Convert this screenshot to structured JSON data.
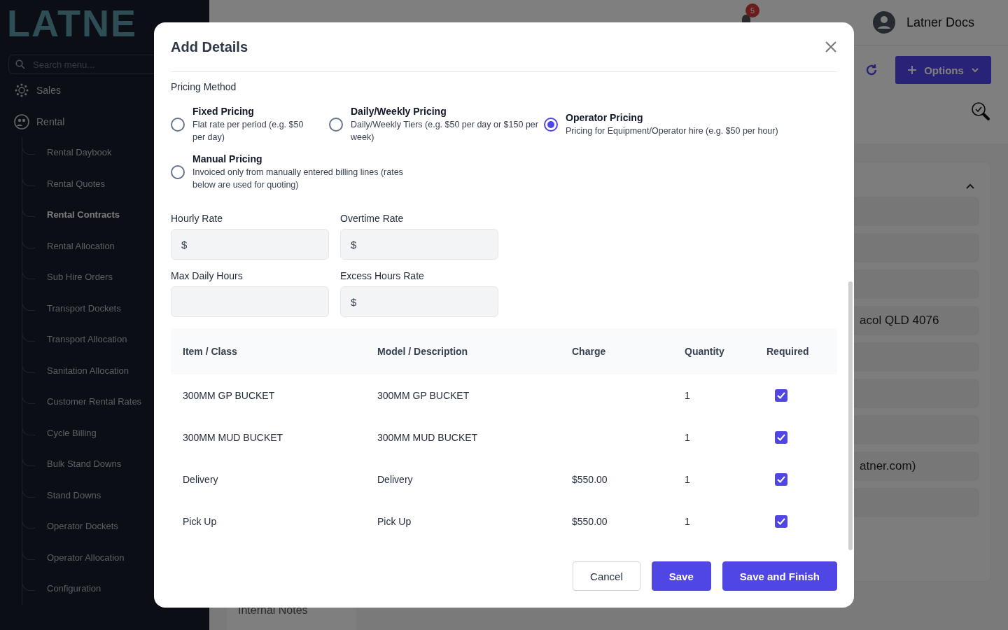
{
  "sidebar": {
    "logo": "LATNE",
    "search": {
      "placeholder": "Search menu..."
    },
    "items": [
      {
        "label": "Sales",
        "kind": "sales"
      },
      {
        "label": "Rental",
        "kind": "rental",
        "children": [
          {
            "label": "Rental Daybook",
            "selected": false
          },
          {
            "label": "Rental Quotes",
            "selected": false
          },
          {
            "label": "Rental Contracts",
            "selected": true
          },
          {
            "label": "Rental Allocation",
            "selected": false
          },
          {
            "label": "Sub Hire Orders",
            "selected": false
          },
          {
            "label": "Transport Dockets",
            "selected": false
          },
          {
            "label": "Transport Allocation",
            "selected": false
          },
          {
            "label": "Sanitation Allocation",
            "selected": false
          },
          {
            "label": "Customer Rental Rates",
            "selected": false
          },
          {
            "label": "Cycle Billing",
            "selected": false
          },
          {
            "label": "Bulk Stand Downs",
            "selected": false
          },
          {
            "label": "Stand Downs",
            "selected": false
          },
          {
            "label": "Operator Dockets",
            "selected": false
          },
          {
            "label": "Operator Allocation",
            "selected": false
          },
          {
            "label": "Configuration",
            "selected": false
          }
        ]
      }
    ]
  },
  "header": {
    "notification_count": "5",
    "user": "Latner Docs"
  },
  "toolbar": {
    "options_button": "Options"
  },
  "details_card": {
    "field_rows": [
      null,
      null,
      null,
      "acol QLD 4076",
      null,
      null,
      null,
      "atner.com)",
      null
    ]
  },
  "notes_card": {
    "title": "Internal Notes"
  },
  "modal": {
    "title": "Add Details",
    "pricing_method": {
      "label": "Pricing Method",
      "options": [
        {
          "title": "Fixed Pricing",
          "description": "Flat rate per period (e.g. $50 per day)",
          "selected": false
        },
        {
          "title": "Daily/Weekly Pricing",
          "description": "Daily/Weekly Tiers (e.g. $50 per day or $150 per week)",
          "selected": false
        },
        {
          "title": "Operator Pricing",
          "description": "Pricing for Equipment/Operator hire (e.g. $50 per hour)",
          "selected": true
        },
        {
          "title": "Manual Pricing",
          "description": "Invoiced only from manually entered billing lines (rates below are used for quoting)",
          "selected": false
        }
      ]
    },
    "fields": [
      {
        "label": "Hourly Rate",
        "prefix": "$"
      },
      {
        "label": "Overtime Rate",
        "prefix": "$"
      },
      {
        "label": "Max Daily Hours"
      },
      {
        "label": "Excess Hours Rate",
        "prefix": "$"
      }
    ],
    "table": {
      "columns": [
        "Item / Class",
        "Model / Description",
        "Charge",
        "Quantity",
        "Required"
      ],
      "rows": [
        {
          "item": "300MM GP BUCKET",
          "model": "300MM GP BUCKET",
          "quantity": "1",
          "required": true
        },
        {
          "item": "300MM MUD BUCKET",
          "model": "300MM MUD BUCKET",
          "quantity": "1",
          "required": true
        },
        {
          "item": "Delivery",
          "model": "Delivery",
          "charge": "$550.00",
          "quantity": "1",
          "required": true
        },
        {
          "item": "Pick Up",
          "model": "Pick Up",
          "charge": "$550.00",
          "quantity": "1",
          "required": true
        }
      ]
    },
    "buttons": [
      {
        "label": "Cancel",
        "kind": "secondary"
      },
      {
        "label": "Save",
        "kind": "primary"
      },
      {
        "label": "Save and Finish",
        "kind": "primary"
      }
    ]
  }
}
